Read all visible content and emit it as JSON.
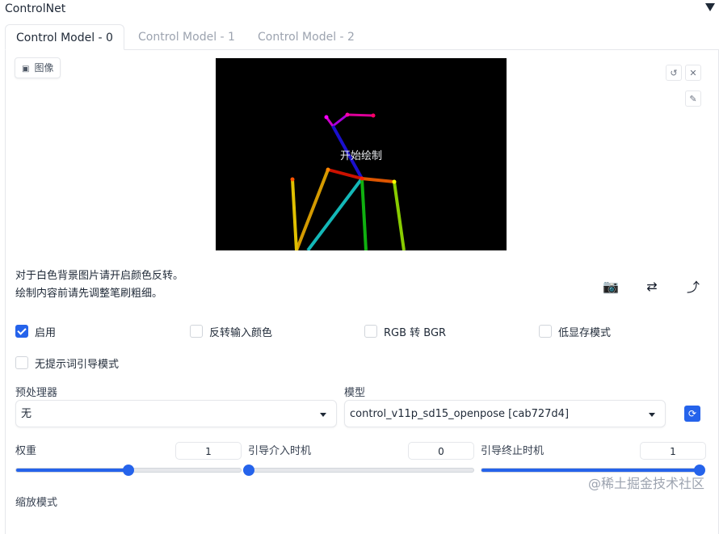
{
  "panel": {
    "title": "ControlNet"
  },
  "tabs": [
    {
      "label": "Control Model - 0",
      "active": true
    },
    {
      "label": "Control Model - 1",
      "active": false
    },
    {
      "label": "Control Model - 2",
      "active": false
    }
  ],
  "image_input": {
    "label": "图像",
    "canvas_overlay": "开始绘制"
  },
  "hints": {
    "line1": "对于白色背景图片请开启颜色反转。",
    "line2": "绘制内容前请先调整笔刷粗细。"
  },
  "checkboxes": [
    {
      "label": "启用",
      "checked": true
    },
    {
      "label": "反转输入颜色",
      "checked": false
    },
    {
      "label": "RGB 转 BGR",
      "checked": false
    },
    {
      "label": "低显存模式",
      "checked": false
    },
    {
      "label": "无提示词引导模式",
      "checked": false
    }
  ],
  "preprocessor": {
    "label": "预处理器",
    "value": "无"
  },
  "model": {
    "label": "模型",
    "value": "control_v11p_sd15_openpose [cab727d4]"
  },
  "sliders": [
    {
      "label": "权重",
      "value": "1",
      "fraction": 0.5
    },
    {
      "label": "引导介入时机",
      "value": "0",
      "fraction": 0.0
    },
    {
      "label": "引导终止时机",
      "value": "1",
      "fraction": 1.0
    }
  ],
  "resize": {
    "label": "缩放模式"
  },
  "watermark": "@稀土掘金技术社区",
  "colors": {
    "accent": "#2563eb",
    "canvas_bg": "#000000"
  }
}
